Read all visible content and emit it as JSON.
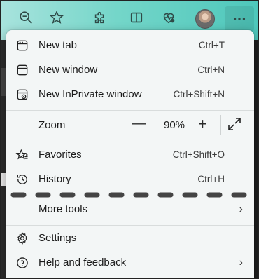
{
  "menu": {
    "items": [
      {
        "label": "New tab",
        "shortcut": "Ctrl+T",
        "icon": "new-tab-icon"
      },
      {
        "label": "New window",
        "shortcut": "Ctrl+N",
        "icon": "new-window-icon"
      },
      {
        "label": "New InPrivate window",
        "shortcut": "Ctrl+Shift+N",
        "icon": "inprivate-icon"
      },
      {
        "label": "Zoom",
        "icon": ""
      },
      {
        "label": "Favorites",
        "shortcut": "Ctrl+Shift+O",
        "icon": "favorites-icon"
      },
      {
        "label": "History",
        "shortcut": "Ctrl+H",
        "icon": "history-icon"
      },
      {
        "label": "More tools",
        "chevron": "›"
      },
      {
        "label": "Settings",
        "icon": "gear-icon"
      },
      {
        "label": "Help and feedback",
        "chevron": "›",
        "icon": "help-icon"
      }
    ],
    "zoom": {
      "minus": "—",
      "value": "90%",
      "plus": "+"
    }
  },
  "toolbar": {
    "icons": [
      "zoom-out-icon",
      "star-icon",
      "extensions-icon",
      "split-screen-icon",
      "browser-essentials-icon",
      "avatar",
      "more-icon"
    ]
  },
  "colors": {
    "toolbar_start": "#a8e3dd",
    "toolbar_end": "#4ec7bb",
    "menu_bg": "#f3f6f6",
    "dash": "#444444"
  }
}
